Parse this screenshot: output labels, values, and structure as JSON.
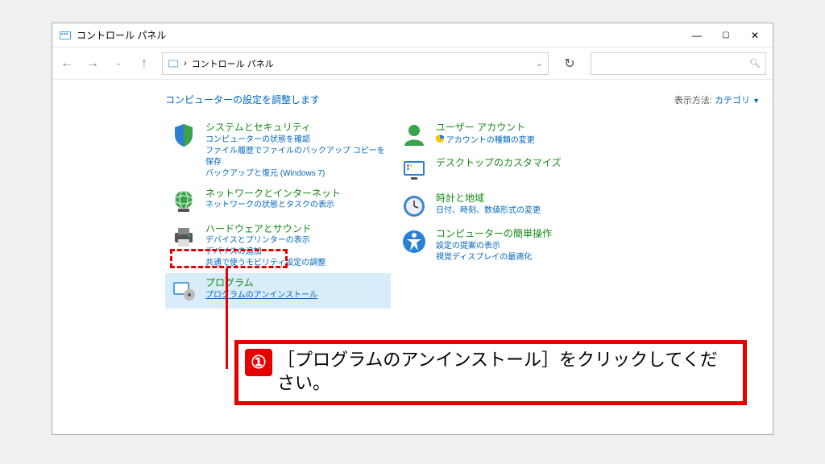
{
  "window": {
    "title": "コントロール パネル"
  },
  "nav": {
    "breadcrumb_sep": "›",
    "breadcrumb": "コントロール パネル"
  },
  "header": {
    "heading": "コンピューターの設定を調整します",
    "viewmode_label": "表示方法: ",
    "viewmode_value": "カテゴリ"
  },
  "left": [
    {
      "title": "システムとセキュリティ",
      "subs": [
        "コンピューターの状態を確認",
        "ファイル履歴でファイルのバックアップ コピーを保存",
        "バックアップと復元 (Windows 7)"
      ]
    },
    {
      "title": "ネットワークとインターネット",
      "subs": [
        "ネットワークの状態とタスクの表示"
      ]
    },
    {
      "title": "ハードウェアとサウンド",
      "subs": [
        "デバイスとプリンターの表示",
        "デバイスの追加",
        "共通で使うモビリティ設定の調整"
      ]
    },
    {
      "title": "プログラム",
      "subs": [
        "プログラムのアンインストール"
      ]
    }
  ],
  "right": [
    {
      "title": "ユーザー アカウント",
      "subs": [
        "アカウントの種類の変更"
      ],
      "shield": true
    },
    {
      "title": "デスクトップのカスタマイズ",
      "subs": []
    },
    {
      "title": "時計と地域",
      "subs": [
        "日付、時刻、数値形式の変更"
      ]
    },
    {
      "title": "コンピューターの簡単操作",
      "subs": [
        "設定の提案の表示",
        "視覚ディスプレイの最適化"
      ]
    }
  ],
  "instruction": {
    "num": "①",
    "text": "［プログラムのアンインストール］をクリックしてください。"
  }
}
